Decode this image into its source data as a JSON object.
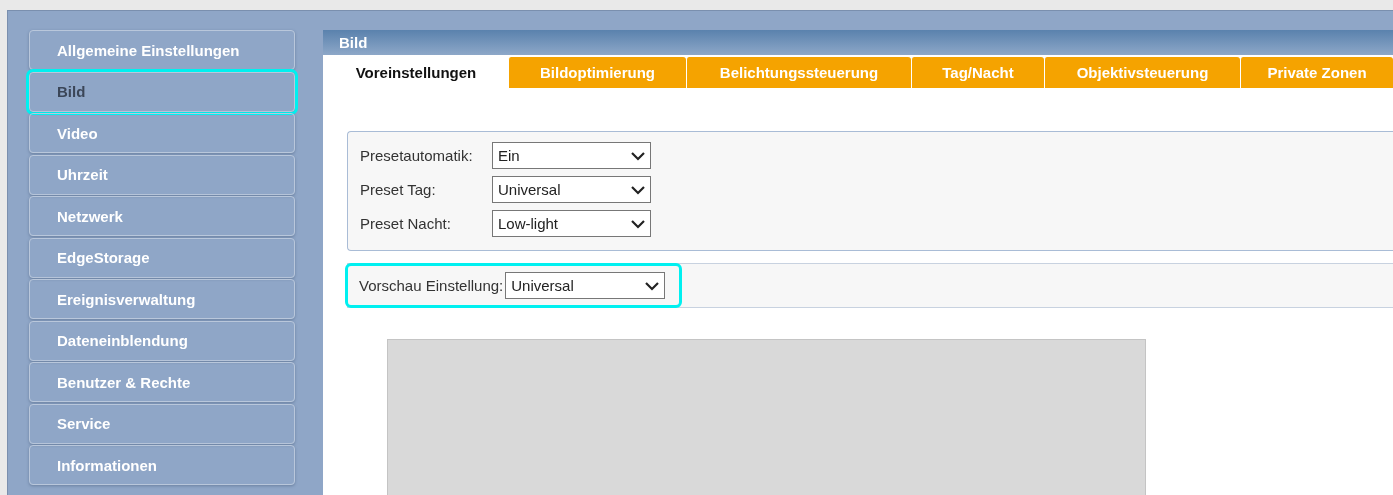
{
  "sidebar": {
    "items": [
      {
        "label": "Allgemeine Einstellungen",
        "selected": false,
        "highlighted": false
      },
      {
        "label": "Bild",
        "selected": true,
        "highlighted": true
      },
      {
        "label": "Video",
        "selected": false,
        "highlighted": false
      },
      {
        "label": "Uhrzeit",
        "selected": false,
        "highlighted": false
      },
      {
        "label": "Netzwerk",
        "selected": false,
        "highlighted": false
      },
      {
        "label": "EdgeStorage",
        "selected": false,
        "highlighted": false
      },
      {
        "label": "Ereignisverwaltung",
        "selected": false,
        "highlighted": false
      },
      {
        "label": "Dateneinblendung",
        "selected": false,
        "highlighted": false
      },
      {
        "label": "Benutzer & Rechte",
        "selected": false,
        "highlighted": false
      },
      {
        "label": "Service",
        "selected": false,
        "highlighted": false
      },
      {
        "label": "Informationen",
        "selected": false,
        "highlighted": false
      }
    ]
  },
  "panel": {
    "title": "Bild"
  },
  "tabs": [
    {
      "label": "Voreinstellungen",
      "selected": true
    },
    {
      "label": "Bildoptimierung",
      "selected": false
    },
    {
      "label": "Belichtungssteuerung",
      "selected": false
    },
    {
      "label": "Tag/Nacht",
      "selected": false
    },
    {
      "label": "Objektivsteuerung",
      "selected": false
    },
    {
      "label": "Private Zonen",
      "selected": false
    }
  ],
  "presets": [
    {
      "label": "Presetautomatik:",
      "value": "Ein"
    },
    {
      "label": "Preset Tag:",
      "value": "Universal"
    },
    {
      "label": "Preset Nacht:",
      "value": "Low-light"
    }
  ],
  "preview_setting": {
    "label": "Vorschau Einstellung:",
    "value": "Universal",
    "highlighted": true
  }
}
